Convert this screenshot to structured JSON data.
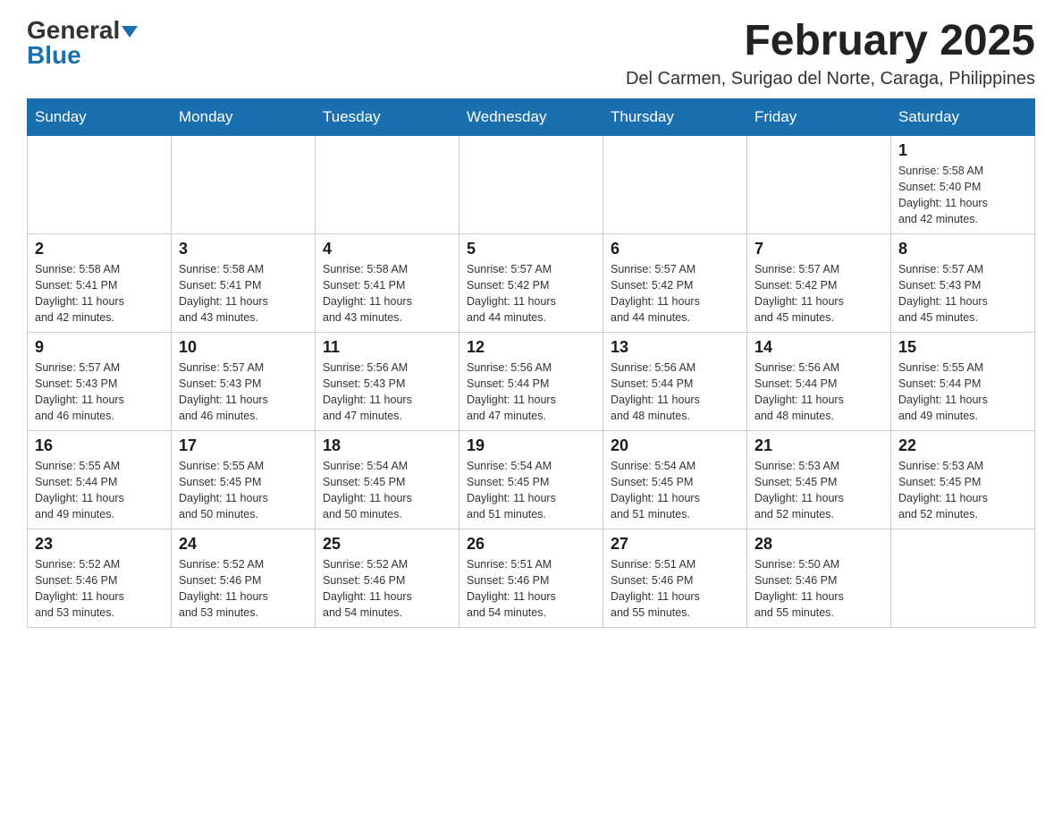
{
  "logo": {
    "general": "General",
    "blue": "Blue"
  },
  "title": "February 2025",
  "location": "Del Carmen, Surigao del Norte, Caraga, Philippines",
  "days_of_week": [
    "Sunday",
    "Monday",
    "Tuesday",
    "Wednesday",
    "Thursday",
    "Friday",
    "Saturday"
  ],
  "weeks": [
    [
      {
        "day": "",
        "info": ""
      },
      {
        "day": "",
        "info": ""
      },
      {
        "day": "",
        "info": ""
      },
      {
        "day": "",
        "info": ""
      },
      {
        "day": "",
        "info": ""
      },
      {
        "day": "",
        "info": ""
      },
      {
        "day": "1",
        "info": "Sunrise: 5:58 AM\nSunset: 5:40 PM\nDaylight: 11 hours\nand 42 minutes."
      }
    ],
    [
      {
        "day": "2",
        "info": "Sunrise: 5:58 AM\nSunset: 5:41 PM\nDaylight: 11 hours\nand 42 minutes."
      },
      {
        "day": "3",
        "info": "Sunrise: 5:58 AM\nSunset: 5:41 PM\nDaylight: 11 hours\nand 43 minutes."
      },
      {
        "day": "4",
        "info": "Sunrise: 5:58 AM\nSunset: 5:41 PM\nDaylight: 11 hours\nand 43 minutes."
      },
      {
        "day": "5",
        "info": "Sunrise: 5:57 AM\nSunset: 5:42 PM\nDaylight: 11 hours\nand 44 minutes."
      },
      {
        "day": "6",
        "info": "Sunrise: 5:57 AM\nSunset: 5:42 PM\nDaylight: 11 hours\nand 44 minutes."
      },
      {
        "day": "7",
        "info": "Sunrise: 5:57 AM\nSunset: 5:42 PM\nDaylight: 11 hours\nand 45 minutes."
      },
      {
        "day": "8",
        "info": "Sunrise: 5:57 AM\nSunset: 5:43 PM\nDaylight: 11 hours\nand 45 minutes."
      }
    ],
    [
      {
        "day": "9",
        "info": "Sunrise: 5:57 AM\nSunset: 5:43 PM\nDaylight: 11 hours\nand 46 minutes."
      },
      {
        "day": "10",
        "info": "Sunrise: 5:57 AM\nSunset: 5:43 PM\nDaylight: 11 hours\nand 46 minutes."
      },
      {
        "day": "11",
        "info": "Sunrise: 5:56 AM\nSunset: 5:43 PM\nDaylight: 11 hours\nand 47 minutes."
      },
      {
        "day": "12",
        "info": "Sunrise: 5:56 AM\nSunset: 5:44 PM\nDaylight: 11 hours\nand 47 minutes."
      },
      {
        "day": "13",
        "info": "Sunrise: 5:56 AM\nSunset: 5:44 PM\nDaylight: 11 hours\nand 48 minutes."
      },
      {
        "day": "14",
        "info": "Sunrise: 5:56 AM\nSunset: 5:44 PM\nDaylight: 11 hours\nand 48 minutes."
      },
      {
        "day": "15",
        "info": "Sunrise: 5:55 AM\nSunset: 5:44 PM\nDaylight: 11 hours\nand 49 minutes."
      }
    ],
    [
      {
        "day": "16",
        "info": "Sunrise: 5:55 AM\nSunset: 5:44 PM\nDaylight: 11 hours\nand 49 minutes."
      },
      {
        "day": "17",
        "info": "Sunrise: 5:55 AM\nSunset: 5:45 PM\nDaylight: 11 hours\nand 50 minutes."
      },
      {
        "day": "18",
        "info": "Sunrise: 5:54 AM\nSunset: 5:45 PM\nDaylight: 11 hours\nand 50 minutes."
      },
      {
        "day": "19",
        "info": "Sunrise: 5:54 AM\nSunset: 5:45 PM\nDaylight: 11 hours\nand 51 minutes."
      },
      {
        "day": "20",
        "info": "Sunrise: 5:54 AM\nSunset: 5:45 PM\nDaylight: 11 hours\nand 51 minutes."
      },
      {
        "day": "21",
        "info": "Sunrise: 5:53 AM\nSunset: 5:45 PM\nDaylight: 11 hours\nand 52 minutes."
      },
      {
        "day": "22",
        "info": "Sunrise: 5:53 AM\nSunset: 5:45 PM\nDaylight: 11 hours\nand 52 minutes."
      }
    ],
    [
      {
        "day": "23",
        "info": "Sunrise: 5:52 AM\nSunset: 5:46 PM\nDaylight: 11 hours\nand 53 minutes."
      },
      {
        "day": "24",
        "info": "Sunrise: 5:52 AM\nSunset: 5:46 PM\nDaylight: 11 hours\nand 53 minutes."
      },
      {
        "day": "25",
        "info": "Sunrise: 5:52 AM\nSunset: 5:46 PM\nDaylight: 11 hours\nand 54 minutes."
      },
      {
        "day": "26",
        "info": "Sunrise: 5:51 AM\nSunset: 5:46 PM\nDaylight: 11 hours\nand 54 minutes."
      },
      {
        "day": "27",
        "info": "Sunrise: 5:51 AM\nSunset: 5:46 PM\nDaylight: 11 hours\nand 55 minutes."
      },
      {
        "day": "28",
        "info": "Sunrise: 5:50 AM\nSunset: 5:46 PM\nDaylight: 11 hours\nand 55 minutes."
      },
      {
        "day": "",
        "info": ""
      }
    ]
  ]
}
